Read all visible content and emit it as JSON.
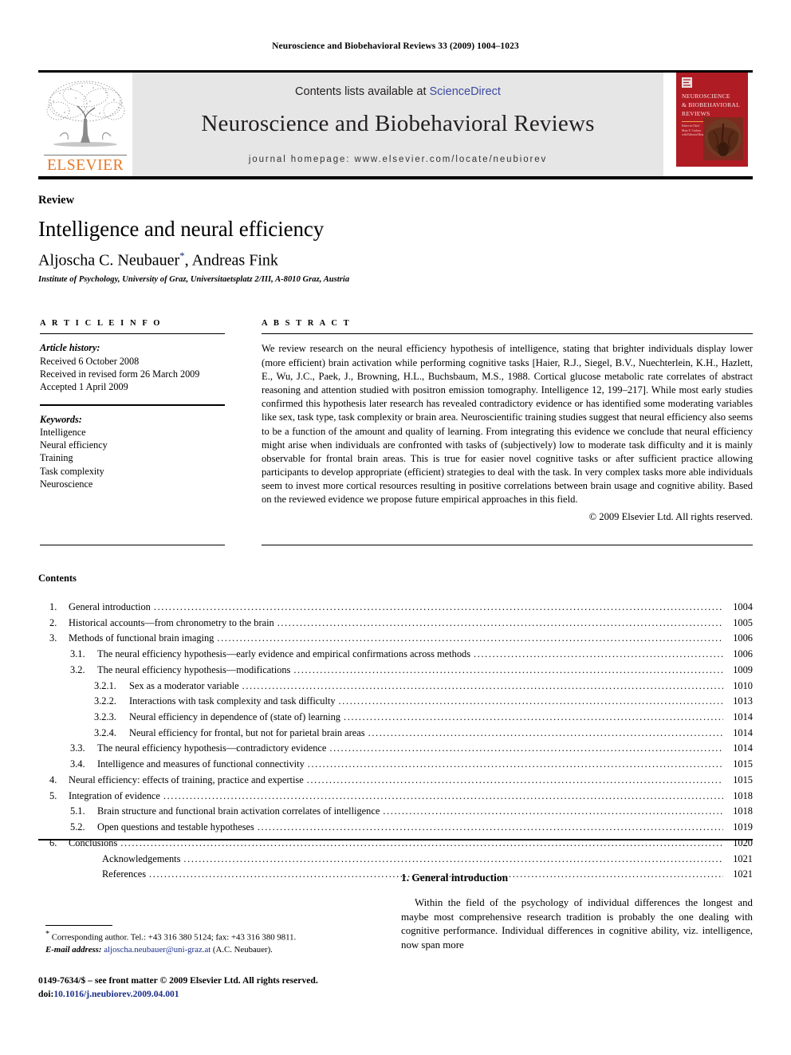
{
  "running_head": "Neuroscience and Biobehavioral Reviews 33 (2009) 1004–1023",
  "masthead": {
    "contents_prefix": "Contents lists available at ",
    "sciencedirect": "ScienceDirect",
    "journal_title": "Neuroscience and Biobehavioral Reviews",
    "homepage": "journal homepage: www.elsevier.com/locate/neubiorev",
    "publisher": "ELSEVIER",
    "publisher_color": "#E87722",
    "link_color": "#3b4ba0",
    "cover": {
      "line1": "NEUROSCIENCE",
      "line2": "& BIOBEHAVIORAL",
      "line3": "REVIEWS",
      "editor_line": "Editor-in-Chief\nMary Ε. Carlson\nwith Editorial Board",
      "bg_color": "#b01c24"
    }
  },
  "article": {
    "doctype": "Review",
    "title": "Intelligence and neural efficiency",
    "authors": "Aljoscha C. Neubauer",
    "authors_tail": ", Andreas Fink",
    "corresponding_mark": "*",
    "affiliation": "Institute of Psychology, University of Graz, Universitaetsplatz 2/III, A-8010 Graz, Austria"
  },
  "article_info": {
    "heading": "A R T I C L E  I N F O",
    "history_label": "Article history:",
    "history": [
      "Received 6 October 2008",
      "Received in revised form 26 March 2009",
      "Accepted 1 April 2009"
    ],
    "keywords_label": "Keywords:",
    "keywords": [
      "Intelligence",
      "Neural efficiency",
      "Training",
      "Task complexity",
      "Neuroscience"
    ]
  },
  "abstract": {
    "heading": "A B S T R A C T",
    "text": "We review research on the neural efficiency hypothesis of intelligence, stating that brighter individuals display lower (more efficient) brain activation while performing cognitive tasks [Haier, R.J., Siegel, B.V., Nuechterlein, K.H., Hazlett, E., Wu, J.C., Paek, J., Browning, H.L., Buchsbaum, M.S., 1988. Cortical glucose metabolic rate correlates of abstract reasoning and attention studied with positron emission tomography. Intelligence 12, 199–217]. While most early studies confirmed this hypothesis later research has revealed contradictory evidence or has identified some moderating variables like sex, task type, task complexity or brain area. Neuroscientific training studies suggest that neural efficiency also seems to be a function of the amount and quality of learning. From integrating this evidence we conclude that neural efficiency might arise when individuals are confronted with tasks of (subjectively) low to moderate task difficulty and it is mainly observable for frontal brain areas. This is true for easier novel cognitive tasks or after sufficient practice allowing participants to develop appropriate (efficient) strategies to deal with the task. In very complex tasks more able individuals seem to invest more cortical resources resulting in positive correlations between brain usage and cognitive ability. Based on the reviewed evidence we propose future empirical approaches in this field.",
    "copyright": "© 2009 Elsevier Ltd. All rights reserved."
  },
  "contents": {
    "heading": "Contents",
    "entries": [
      {
        "level": 1,
        "num": "1.",
        "label": "General introduction",
        "page": "1004"
      },
      {
        "level": 1,
        "num": "2.",
        "label": "Historical accounts—from chronometry to the brain",
        "page": "1005"
      },
      {
        "level": 1,
        "num": "3.",
        "label": "Methods of functional brain imaging",
        "page": "1006"
      },
      {
        "level": 2,
        "num": "3.1.",
        "label": "The neural efficiency hypothesis—early evidence and empirical confirmations across methods",
        "page": "1006"
      },
      {
        "level": 2,
        "num": "3.2.",
        "label": "The neural efficiency hypothesis—modifications",
        "page": "1009"
      },
      {
        "level": 3,
        "num": "3.2.1.",
        "label": "Sex as a moderator variable",
        "page": "1010"
      },
      {
        "level": 3,
        "num": "3.2.2.",
        "label": "Interactions with task complexity and task difficulty",
        "page": "1013"
      },
      {
        "level": 3,
        "num": "3.2.3.",
        "label": "Neural efficiency in dependence of (state of) learning",
        "page": "1014"
      },
      {
        "level": 3,
        "num": "3.2.4.",
        "label": "Neural efficiency for frontal, but not for parietal brain areas",
        "page": "1014"
      },
      {
        "level": 2,
        "num": "3.3.",
        "label": "The neural efficiency hypothesis—contradictory evidence",
        "page": "1014"
      },
      {
        "level": 2,
        "num": "3.4.",
        "label": "Intelligence and measures of functional connectivity",
        "page": "1015"
      },
      {
        "level": 1,
        "num": "4.",
        "label": "Neural efficiency: effects of training, practice and expertise",
        "page": "1015"
      },
      {
        "level": 1,
        "num": "5.",
        "label": "Integration of evidence",
        "page": "1018"
      },
      {
        "level": 2,
        "num": "5.1.",
        "label": "Brain structure and functional brain activation correlates of intelligence",
        "page": "1018"
      },
      {
        "level": 2,
        "num": "5.2.",
        "label": "Open questions and testable hypotheses",
        "page": "1019"
      },
      {
        "level": 1,
        "num": "6.",
        "label": "Conclusions",
        "page": "1020"
      },
      {
        "level": 0,
        "num": "",
        "label": "Acknowledgements",
        "page": "1021"
      },
      {
        "level": 0,
        "num": "",
        "label": "References",
        "page": "1021"
      }
    ]
  },
  "introduction": {
    "heading": "1. General introduction",
    "paragraph": "Within the field of the psychology of individual differences the longest and maybe most comprehensive research tradition is probably the one dealing with cognitive performance. Individual differences in cognitive ability, viz. intelligence, now span more"
  },
  "footnote": {
    "marker": "*",
    "corresponding": "Corresponding author. Tel.: +43 316 380 5124; fax: +43 316 380 9811.",
    "email_label": "E-mail address:",
    "email": "aljoscha.neubauer@uni-graz.at",
    "email_suffix": " (A.C. Neubauer).",
    "link_color": "#1b2f8b"
  },
  "imprint": {
    "line1": "0149-7634/$ – see front matter © 2009 Elsevier Ltd. All rights reserved.",
    "doi_label": "doi:",
    "doi": "10.1016/j.neubiorev.2009.04.001"
  }
}
